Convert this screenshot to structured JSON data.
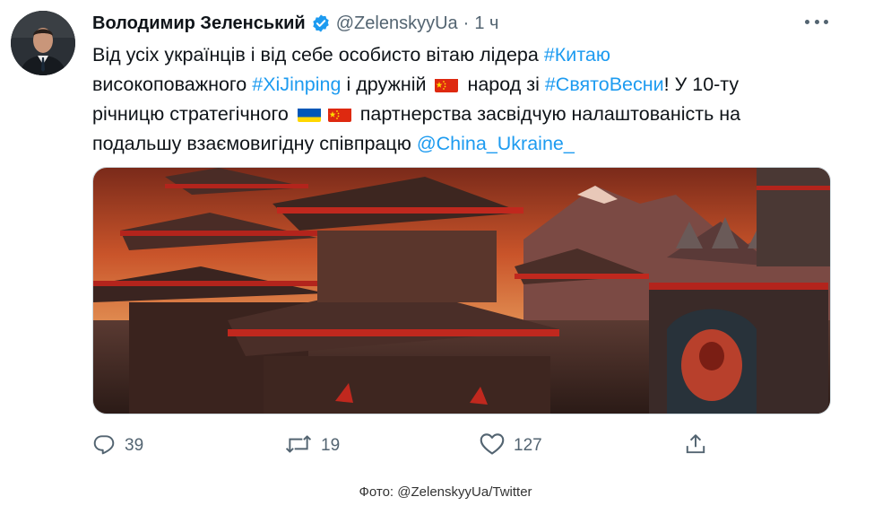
{
  "tweet": {
    "author_name": "Володимир Зеленський",
    "handle": "@ZelenskyyUa",
    "separator": "·",
    "time": "1 ч",
    "text_line1_a": "Від усіх українців і від себе особисто вітаю лідера ",
    "text_line1_tag": "#Китаю",
    "text_line2_a": "високоповажного ",
    "text_line2_tag": "#XiJinping",
    "text_line2_b": " і дружній ",
    "text_line2_c": " народ зі ",
    "text_line2_tag2": "#СвятоВесни",
    "text_line2_d": "! У 10-ту",
    "text_line3_a": "річницю стратегічного ",
    "text_line3_b": " партнерства засвідчую налаштованість на",
    "text_line4_a": "подальшу взаємовигідну співпрацю ",
    "text_line4_mention": "@China_Ukraine_",
    "replies": "39",
    "retweets": "19",
    "likes": "127"
  },
  "icons": {
    "avatar": "avatar",
    "verified": "verified-badge-icon",
    "more": "more-icon",
    "reply": "reply-icon",
    "retweet": "retweet-icon",
    "like": "heart-icon",
    "share": "share-icon",
    "flag_china": "china-flag-icon",
    "flag_ukraine": "ukraine-flag-icon"
  },
  "colors": {
    "link": "#1d9bf0",
    "verified": "#1d9bf0",
    "muted": "#536471"
  },
  "caption": "Фото: @ZelenskyyUa/Twitter"
}
